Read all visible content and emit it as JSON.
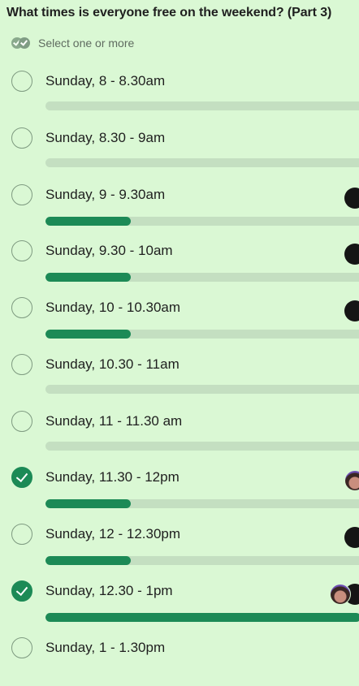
{
  "poll": {
    "title": "What times is everyone free on the weekend? (Part 3)",
    "subtitle": "Select one or more",
    "subtitle_icon": "multi-check-icon"
  },
  "colors": {
    "background": "#daf8d4",
    "accent": "#1c8a56",
    "bar_track": "#c4dfc1"
  },
  "options": [
    {
      "label": "Sunday, 8 - 8.30am",
      "checked": false,
      "vote_fraction": 0,
      "voters": []
    },
    {
      "label": "Sunday, 8.30 - 9am",
      "checked": false,
      "vote_fraction": 0,
      "voters": []
    },
    {
      "label": "Sunday, 9 - 9.30am",
      "checked": false,
      "vote_fraction": 0.5,
      "voters": [
        "dark-avatar"
      ]
    },
    {
      "label": "Sunday, 9.30 - 10am",
      "checked": false,
      "vote_fraction": 0.5,
      "voters": [
        "dark-avatar"
      ]
    },
    {
      "label": "Sunday, 10 - 10.30am",
      "checked": false,
      "vote_fraction": 0.5,
      "voters": [
        "dark-avatar"
      ]
    },
    {
      "label": "Sunday, 10.30 - 11am",
      "checked": false,
      "vote_fraction": 0,
      "voters": []
    },
    {
      "label": "Sunday, 11 - 11.30 am",
      "checked": false,
      "vote_fraction": 0,
      "voters": []
    },
    {
      "label": "Sunday, 11.30 - 12pm",
      "checked": true,
      "vote_fraction": 0.5,
      "voters": [
        "photo-avatar"
      ]
    },
    {
      "label": "Sunday, 12 - 12.30pm",
      "checked": false,
      "vote_fraction": 0.5,
      "voters": [
        "dark-avatar"
      ]
    },
    {
      "label": "Sunday, 12.30 - 1pm",
      "checked": true,
      "vote_fraction": 1,
      "voters": [
        "photo-avatar",
        "dark-avatar"
      ]
    },
    {
      "label": "Sunday, 1 - 1.30pm",
      "checked": false,
      "vote_fraction": null,
      "voters": []
    }
  ]
}
